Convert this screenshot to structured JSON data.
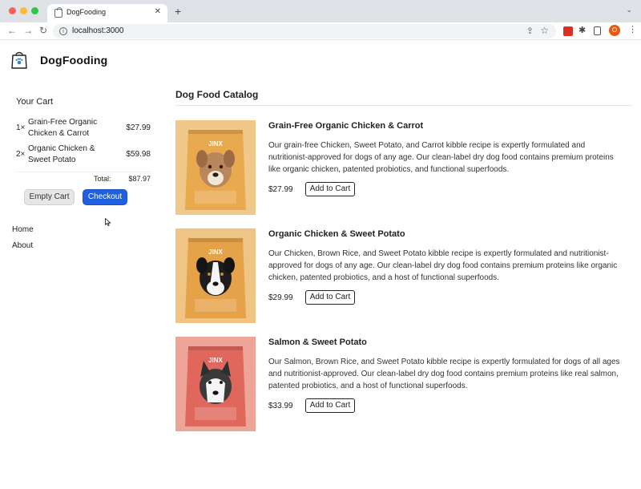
{
  "browser": {
    "tab_title": "DogFooding",
    "url": "localhost:3000",
    "profile_initial": "O"
  },
  "header": {
    "brand_name": "DogFooding"
  },
  "cart": {
    "title": "Your Cart",
    "items": [
      {
        "qty": "1×",
        "name": "Grain-Free Organic Chicken & Carrot",
        "price": "$27.99"
      },
      {
        "qty": "2×",
        "name": "Organic Chicken & Sweet Potato",
        "price": "$59.98"
      }
    ],
    "total_label": "Total:",
    "total_value": "$87.97",
    "empty_label": "Empty Cart",
    "checkout_label": "Checkout"
  },
  "nav": {
    "home": "Home",
    "about": "About"
  },
  "catalog": {
    "title": "Dog Food Catalog",
    "products": [
      {
        "name": "Grain-Free Organic Chicken & Carrot",
        "description": "Our grain-free Chicken, Sweet Potato, and Carrot kibble recipe is expertly formulated and nutritionist-approved for dogs of any age. Our clean-label dry dog food contains premium proteins like organic chicken, patented probiotics, and functional superfoods.",
        "price": "$27.99",
        "button": "Add to Cart",
        "brand_on_bag": "JINX",
        "bag_color": "#e9a94f",
        "bg_color": "#f0c98a"
      },
      {
        "name": "Organic Chicken & Sweet Potato",
        "description": "Our Chicken, Brown Rice, and Sweet Potato kibble recipe is expertly formulated and nutritionist-approved for dogs of any age. Our clean-label dry dog food contains premium proteins like organic chicken, patented probiotics, and a host of functional superfoods.",
        "price": "$29.99",
        "button": "Add to Cart",
        "brand_on_bag": "JINX",
        "bag_color": "#e6a248",
        "bg_color": "#eec585"
      },
      {
        "name": "Salmon & Sweet Potato",
        "description": "Our Salmon, Brown Rice, and Sweet Potato kibble recipe is expertly formulated for dogs of all ages and nutritionist-approved. Our clean-label dry dog food contains premium proteins like real salmon, patented probiotics, and a host of functional superfoods.",
        "price": "$33.99",
        "button": "Add to Cart",
        "brand_on_bag": "JINX",
        "bag_color": "#e0675c",
        "bg_color": "#eea597"
      }
    ]
  }
}
